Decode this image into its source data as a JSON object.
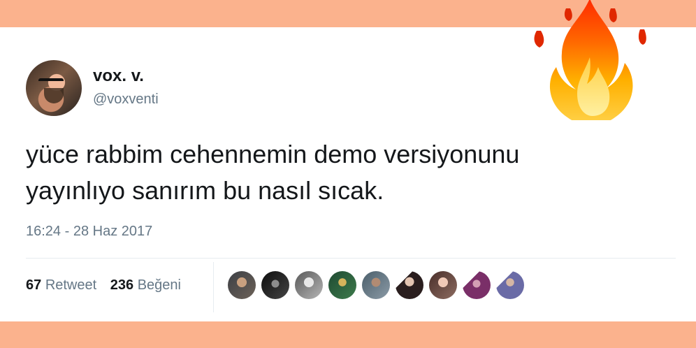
{
  "tweet": {
    "display_name": "vox. v.",
    "handle": "@voxventi",
    "text": "yüce rabbim cehennemin demo versiyonunu\nyayınlıyo sanırım bu nasıl sıcak.",
    "timestamp": "16:24 - 28 Haz 2017"
  },
  "stats": {
    "retweet_count": "67",
    "retweet_label": "Retweet",
    "like_count": "236",
    "like_label": "Beğeni"
  },
  "decoration": {
    "emoji": "fire-emoji",
    "frame_color": "#fbb28d"
  }
}
